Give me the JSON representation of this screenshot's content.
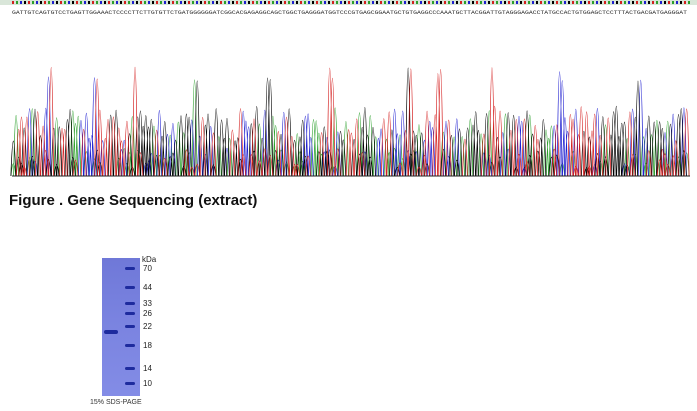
{
  "figure": {
    "caption": "Figure . Gene Sequencing (extract)"
  },
  "sequence": {
    "text": "GATTGTCAGTGTCCTGAGTTGGAAACTCCCCTTCTTGTGTTCTGATGGGGGGATCGGCACGAGAGGCAGCTGGCTGAGGGATGGTCCCGTGAGCGGAATGCTGTGAGGCCCAAATGCTTACGGATTGTAGGGAGACCTATGCCACTGTGGAGCTCCTTTACTGACGATGAGGGAT"
  },
  "trace_colors": {
    "A": "#2ca02c",
    "C": "#1f1fd0",
    "G": "#000000",
    "T": "#d42020"
  },
  "gel": {
    "unit": "kDa",
    "markers": [
      "70",
      "44",
      "33",
      "26",
      "22",
      "18",
      "14",
      "10"
    ],
    "caption": "15% SDS-PAGE",
    "lane_color": "#7a83e0",
    "band_color": "#1e2b9e"
  }
}
